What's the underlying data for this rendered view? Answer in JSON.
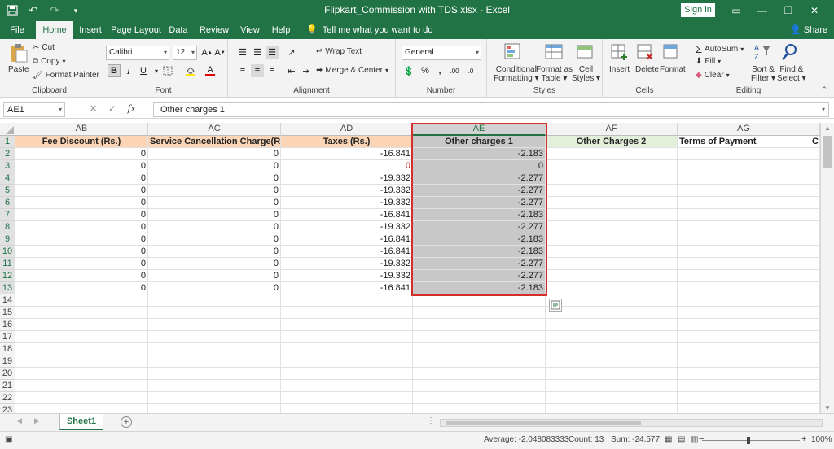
{
  "title_bar": {
    "title": "Flipkart_Commission with TDS.xlsx  -  Excel",
    "sign_in": "Sign in"
  },
  "tabs": [
    "File",
    "Home",
    "Insert",
    "Page Layout",
    "Data",
    "Review",
    "View",
    "Help"
  ],
  "active_tab": "Home",
  "tell_me": "Tell me what you want to do",
  "share": "Share",
  "ribbon": {
    "clipboard": {
      "paste": "Paste",
      "cut": "Cut",
      "copy": "Copy",
      "format_painter": "Format Painter",
      "label": "Clipboard"
    },
    "font": {
      "name": "Calibri",
      "size": "12",
      "label": "Font"
    },
    "alignment": {
      "wrap_text": "Wrap Text",
      "merge_center": "Merge & Center",
      "label": "Alignment"
    },
    "number": {
      "format": "General",
      "label": "Number"
    },
    "styles": {
      "conditional": [
        "Conditional",
        "Formatting"
      ],
      "format_table": [
        "Format as",
        "Table"
      ],
      "cell_styles": [
        "Cell",
        "Styles"
      ],
      "label": "Styles"
    },
    "cells": {
      "insert": "Insert",
      "delete": "Delete",
      "format": "Format",
      "label": "Cells"
    },
    "editing": {
      "autosum": "AutoSum",
      "fill": "Fill",
      "clear": "Clear",
      "sort_filter": [
        "Sort &",
        "Filter"
      ],
      "find_select": [
        "Find &",
        "Select"
      ],
      "label": "Editing"
    }
  },
  "formula_bar": {
    "name_box": "AE1",
    "formula": "Other charges 1"
  },
  "grid": {
    "columns": [
      "AB",
      "AC",
      "AD",
      "AE",
      "AF",
      "AG",
      ""
    ],
    "headers": [
      "Fee Discount (Rs.)",
      "Service Cancellation Charge(Rs.)",
      "Taxes (Rs.)",
      "Other charges 1",
      "Other Charges 2",
      "Terms of Payment",
      "Co"
    ],
    "row_numbers": [
      "1",
      "2",
      "3",
      "4",
      "5",
      "6",
      "7",
      "8",
      "9",
      "10",
      "11",
      "12",
      "13",
      "14",
      "15",
      "16",
      "17",
      "18",
      "19",
      "20",
      "21",
      "22",
      "23"
    ],
    "data_rows": [
      [
        "0",
        "0",
        "-16.841",
        "-2.183"
      ],
      [
        "0",
        "0",
        "0",
        "0"
      ],
      [
        "0",
        "0",
        "-19.332",
        "-2.277"
      ],
      [
        "0",
        "0",
        "-19.332",
        "-2.277"
      ],
      [
        "0",
        "0",
        "-19.332",
        "-2.277"
      ],
      [
        "0",
        "0",
        "-16.841",
        "-2.183"
      ],
      [
        "0",
        "0",
        "-19.332",
        "-2.277"
      ],
      [
        "0",
        "0",
        "-16.841",
        "-2.183"
      ],
      [
        "0",
        "0",
        "-16.841",
        "-2.183"
      ],
      [
        "0",
        "0",
        "-19.332",
        "-2.277"
      ],
      [
        "0",
        "0",
        "-19.332",
        "-2.277"
      ],
      [
        "0",
        "0",
        "-16.841",
        "-2.183"
      ]
    ]
  },
  "sheet_tabs": [
    "Sheet1"
  ],
  "status_bar": {
    "average": "Average: -2.048083333",
    "count": "Count: 13",
    "sum": "Sum: -24.577",
    "zoom": "100%"
  },
  "colors": {
    "excel_green": "#217346",
    "header_fill_orange": "#fbd5b5",
    "header_fill_green": "#e2efda",
    "selection_fill": "#c8c8c8",
    "highlight_border": "#d32f2f",
    "zero_red": "#c00000"
  }
}
